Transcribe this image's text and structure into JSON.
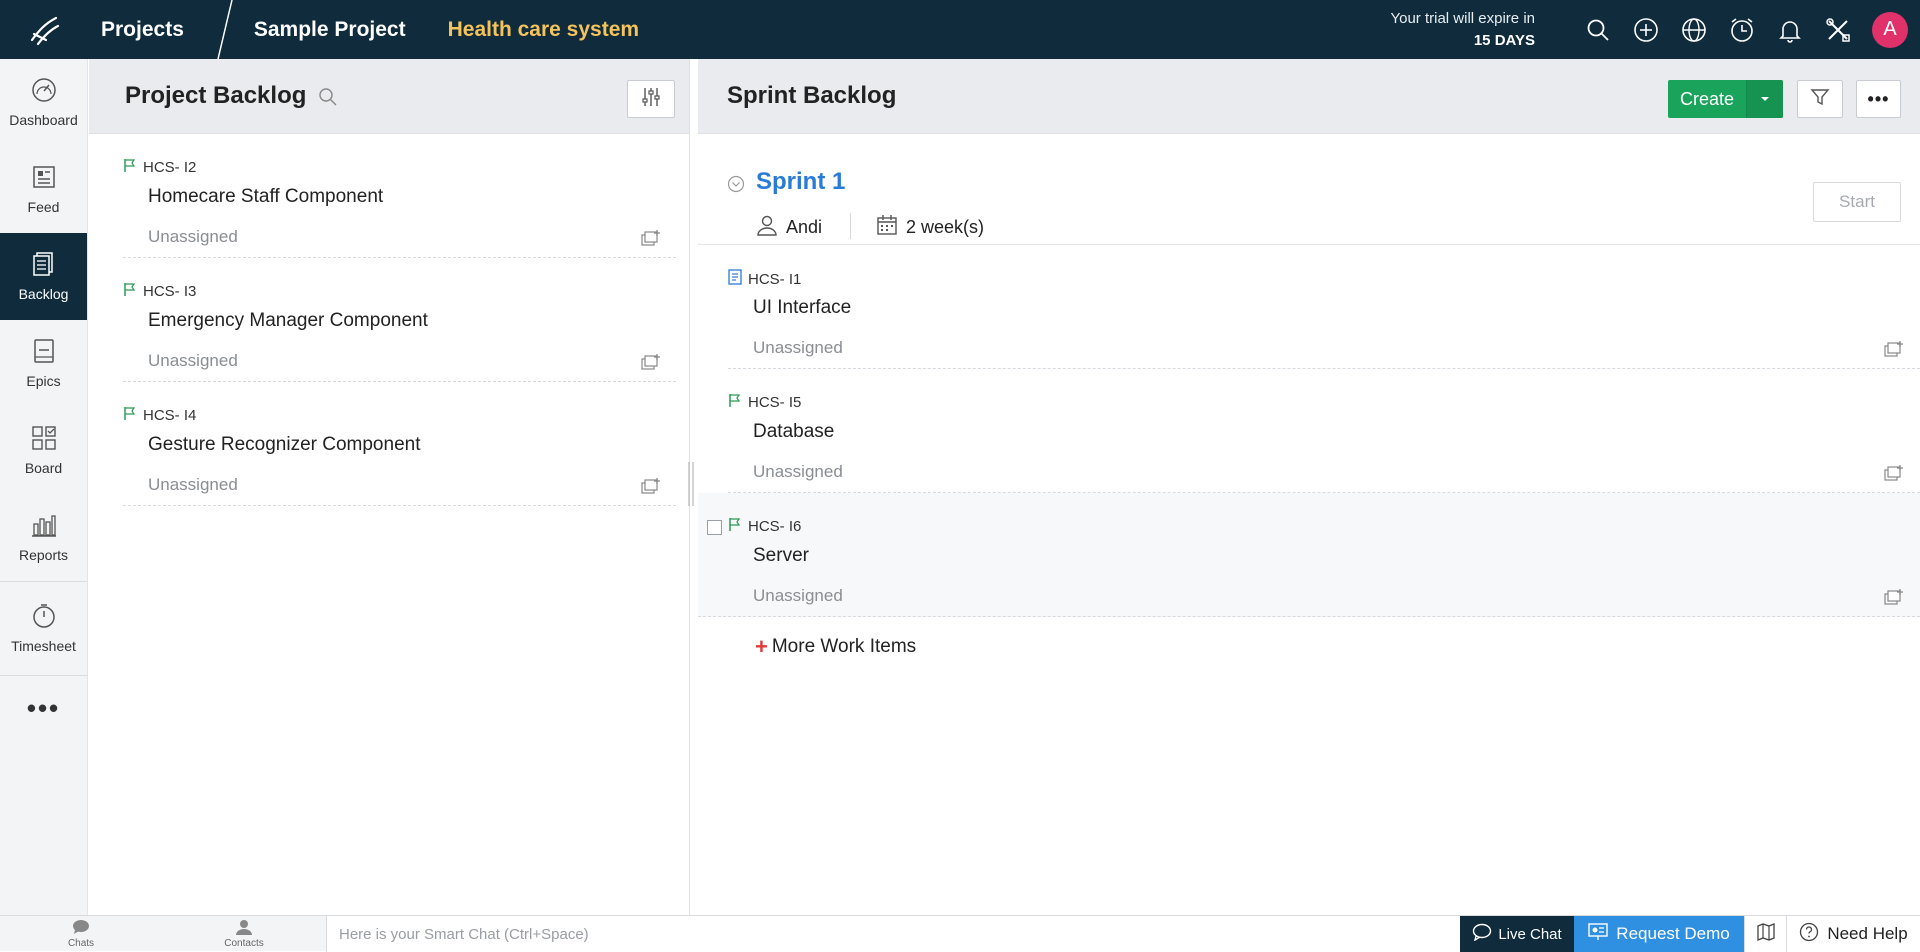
{
  "header": {
    "projects_label": "Projects",
    "project_name": "Sample Project",
    "module_name": "Health care system",
    "trial_line1": "Your trial will expire in",
    "trial_line2": "15 DAYS",
    "avatar_initial": "A",
    "icons": [
      "search-icon",
      "add-icon",
      "globe-icon",
      "clock-icon",
      "bell-icon",
      "tools-icon"
    ]
  },
  "sidebar": {
    "items": [
      {
        "label": "Dashboard",
        "icon": "dashboard-icon"
      },
      {
        "label": "Feed",
        "icon": "feed-icon"
      },
      {
        "label": "Backlog",
        "icon": "backlog-icon",
        "active": true
      },
      {
        "label": "Epics",
        "icon": "epics-icon"
      },
      {
        "label": "Board",
        "icon": "board-icon"
      },
      {
        "label": "Reports",
        "icon": "reports-icon"
      },
      {
        "label": "Timesheet",
        "icon": "timer-icon"
      }
    ],
    "more_label": "•••"
  },
  "project_backlog": {
    "title": "Project Backlog",
    "items": [
      {
        "id": "HCS- I2",
        "title": "Homecare Staff Component",
        "assignee": "Unassigned"
      },
      {
        "id": "HCS- I3",
        "title": "Emergency Manager Component",
        "assignee": "Unassigned"
      },
      {
        "id": "HCS- I4",
        "title": "Gesture Recognizer Component",
        "assignee": "Unassigned"
      }
    ]
  },
  "sprint_backlog": {
    "title": "Sprint Backlog",
    "create_label": "Create",
    "more_label": "•••",
    "sprint": {
      "name": "Sprint 1",
      "owner": "Andi",
      "duration": "2 week(s)",
      "start_label": "Start"
    },
    "items": [
      {
        "id": "HCS- I1",
        "title": "UI Interface",
        "assignee": "Unassigned",
        "type_icon": "story-icon"
      },
      {
        "id": "HCS- I5",
        "title": "Database",
        "assignee": "Unassigned",
        "type_icon": "flag-icon"
      },
      {
        "id": "HCS- I6",
        "title": "Server",
        "assignee": "Unassigned",
        "type_icon": "flag-icon"
      }
    ],
    "more_items_label": "More Work Items"
  },
  "bottombar": {
    "chats_label": "Chats",
    "contacts_label": "Contacts",
    "smartchat_placeholder": "Here is your Smart Chat (Ctrl+Space)",
    "livechat_label": "Live Chat",
    "request_demo_label": "Request Demo",
    "need_help_label": "Need Help"
  },
  "colors": {
    "topbar": "#0f2b3c",
    "module_accent": "#f5c35c",
    "create_button": "#1aa35b",
    "sprint_name": "#2a7bd8",
    "avatar": "#e0316b",
    "request_demo": "#2f8fe0"
  }
}
